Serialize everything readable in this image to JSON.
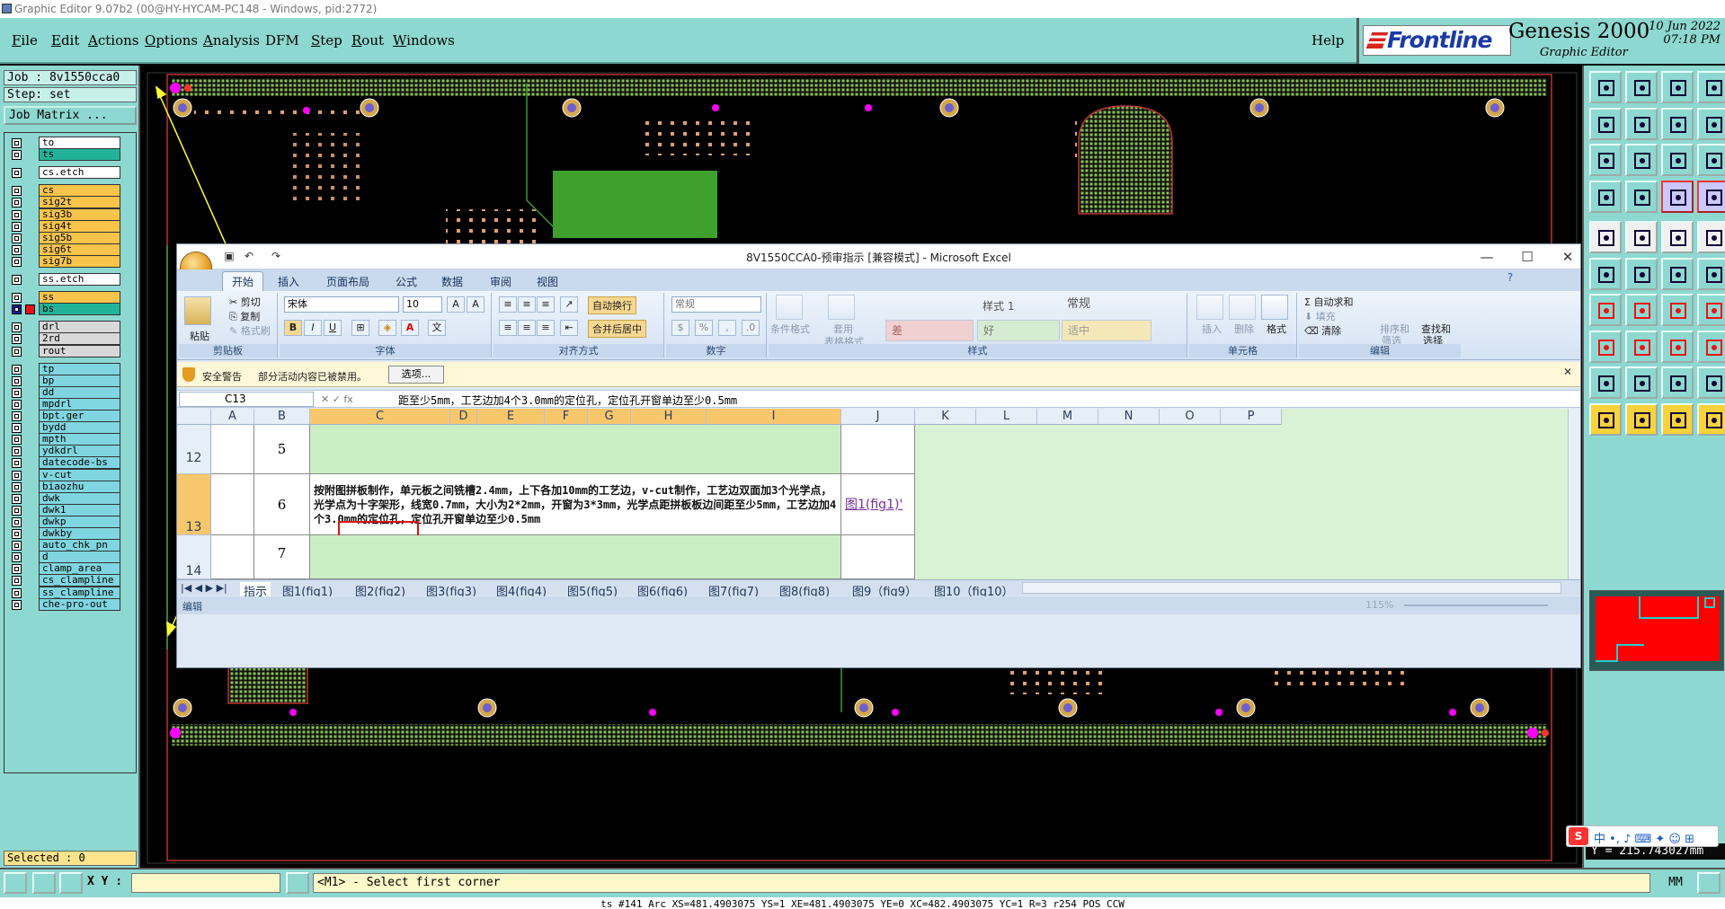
{
  "titlebar": {
    "text": "Graphic Editor 9.07b2 (00@HY-HYCAM-PC148 - Windows, pid:2772)"
  },
  "menu": {
    "items": [
      {
        "label": "File",
        "underline": "F",
        "rest": "ile"
      },
      {
        "label": "Edit",
        "underline": "E",
        "rest": "dit"
      },
      {
        "label": "Actions",
        "underline": "A",
        "rest": "ctions"
      },
      {
        "label": "Options",
        "underline": "O",
        "rest": "ptions"
      },
      {
        "label": "Analysis",
        "underline": "A",
        "rest": "nalysis"
      },
      {
        "label": "DFM",
        "underline": "",
        "rest": "DFM"
      },
      {
        "label": "Step",
        "underline": "S",
        "rest": "tep"
      },
      {
        "label": "Rout",
        "underline": "R",
        "rest": "out"
      },
      {
        "label": "Windows",
        "underline": "W",
        "rest": "indows"
      }
    ],
    "help": "Help"
  },
  "brand": {
    "logo": "Frontline",
    "product": "Genesis 2000",
    "subtitle": "Graphic Editor",
    "date": "10 Jun 2022",
    "time": "07:18 PM"
  },
  "left": {
    "job": "Job : 8v1550cca0",
    "step": "Step: set",
    "job_matrix": "Job Matrix ...",
    "selected": "Selected : 0",
    "layers": [
      {
        "name": "to",
        "color": "#ffffff",
        "gap": false
      },
      {
        "name": "ts",
        "color": "#22b39a",
        "gap": false
      },
      {
        "name": "cs.etch",
        "color": "#ffffff",
        "gap": true
      },
      {
        "name": "cs",
        "color": "#f8c44a",
        "gap": true
      },
      {
        "name": "sig2t",
        "color": "#f8c44a",
        "gap": false
      },
      {
        "name": "sig3b",
        "color": "#f8c44a",
        "gap": false
      },
      {
        "name": "sig4t",
        "color": "#f8c44a",
        "gap": false
      },
      {
        "name": "sig5b",
        "color": "#f8c44a",
        "gap": false
      },
      {
        "name": "sig6t",
        "color": "#f8c44a",
        "gap": false
      },
      {
        "name": "sig7b",
        "color": "#f8c44a",
        "gap": false
      },
      {
        "name": "ss.etch",
        "color": "#ffffff",
        "gap": true
      },
      {
        "name": "ss",
        "color": "#f8c44a",
        "gap": true
      },
      {
        "name": "bs",
        "color": "#22b39a",
        "gap": false,
        "active": true
      },
      {
        "name": "drl",
        "color": "#d8d8d8",
        "gap": true
      },
      {
        "name": "2rd",
        "color": "#d8d8d8",
        "gap": false
      },
      {
        "name": "rout",
        "color": "#d8d8d8",
        "gap": false
      },
      {
        "name": "tp",
        "color": "#7fd6e0",
        "gap": true
      },
      {
        "name": "bp",
        "color": "#7fd6e0",
        "gap": false
      },
      {
        "name": "dd",
        "color": "#7fd6e0",
        "gap": false
      },
      {
        "name": "mpdrl",
        "color": "#7fd6e0",
        "gap": false
      },
      {
        "name": "bpt.ger",
        "color": "#7fd6e0",
        "gap": false
      },
      {
        "name": "bydd",
        "color": "#7fd6e0",
        "gap": false
      },
      {
        "name": "mpth",
        "color": "#7fd6e0",
        "gap": false
      },
      {
        "name": "ydkdrl",
        "color": "#7fd6e0",
        "gap": false
      },
      {
        "name": "datecode-bs",
        "color": "#7fd6e0",
        "gap": false
      },
      {
        "name": "v-cut",
        "color": "#7fd6e0",
        "gap": false
      },
      {
        "name": "biaozhu",
        "color": "#7fd6e0",
        "gap": false
      },
      {
        "name": "dwk",
        "color": "#7fd6e0",
        "gap": false
      },
      {
        "name": "dwk1",
        "color": "#7fd6e0",
        "gap": false
      },
      {
        "name": "dwkp",
        "color": "#7fd6e0",
        "gap": false
      },
      {
        "name": "dwkby",
        "color": "#7fd6e0",
        "gap": false
      },
      {
        "name": "auto_chk_pn",
        "color": "#7fd6e0",
        "gap": false
      },
      {
        "name": "d",
        "color": "#7fd6e0",
        "gap": false
      },
      {
        "name": "clamp_area",
        "color": "#7fd6e0",
        "gap": false
      },
      {
        "name": "cs_clampline",
        "color": "#7fd6e0",
        "gap": false
      },
      {
        "name": "ss_clampline",
        "color": "#7fd6e0",
        "gap": false
      },
      {
        "name": "che-pro-out",
        "color": "#7fd6e0",
        "gap": false
      }
    ]
  },
  "excel": {
    "title": "8V1550CCA0-预审指示 [兼容模式] - Microsoft Excel",
    "tabs": [
      "开始",
      "插入",
      "页面布局",
      "公式",
      "数据",
      "审阅",
      "视图"
    ],
    "ribbon": {
      "clipboard": {
        "paste": "粘贴",
        "cut": "剪切",
        "copy": "复制",
        "format_painter": "格式刷",
        "label": "剪贴板"
      },
      "font": {
        "name": "宋体",
        "size": "10",
        "label": "字体"
      },
      "align": {
        "wrap": "自动换行",
        "merge": "合并后居中",
        "label": "对齐方式"
      },
      "number": {
        "format": "常规",
        "label": "数字"
      },
      "styles": {
        "cond": "条件格式",
        "table": "套用",
        "table2": "表格格式",
        "s1": "样式 1",
        "normal": "常规",
        "bad": "差",
        "good": "好",
        "neutral": "适中",
        "label": "样式"
      },
      "cells": {
        "insert": "插入",
        "delete": "删除",
        "format": "格式",
        "label": "单元格"
      },
      "edit": {
        "autosum": "自动求和",
        "fill": "填充",
        "clear": "清除",
        "sort": "排序和",
        "sort2": "筛选",
        "find": "查找和",
        "find2": "选择",
        "label": "编辑"
      }
    },
    "security": {
      "title": "安全警告",
      "message": "部分活动内容已被禁用。",
      "options": "选项..."
    },
    "namebox": "C13",
    "formula": "距至少5mm，工艺边加4个3.0mm的定位孔，定位孔开窗单边至少0.5mm",
    "columns": [
      "A",
      "B",
      "C",
      "D",
      "E",
      "F",
      "G",
      "H",
      "I",
      "J",
      "K",
      "L",
      "M",
      "N",
      "O",
      "P"
    ],
    "rows": [
      {
        "num": "12",
        "b": "5",
        "c": "",
        "j": ""
      },
      {
        "num": "13",
        "b": "6",
        "c": "按附图拼板制作，单元板之间铣槽2.4mm，上下各加10mm的工艺边，v-cut制作，工艺边双面加3个光学点，光学点为十字架形，线宽0.7mm，大小为2*2mm，开窗为3*3mm，光学点距拼板板边间距至少5mm，工艺边加4个3.0mm的定位孔，定位孔开窗单边至少0.5mm",
        "j": "图1(fig1)'"
      },
      {
        "num": "14",
        "b": "7",
        "c": "",
        "j": ""
      }
    ],
    "sheets": [
      "指示",
      "图1(fig1)",
      "图2(fig2)",
      "图3(fig3)",
      "图4(fig4)",
      "图5(fig5)",
      "图6(fig6)",
      "图7(fig7)",
      "图8(fig8)",
      "图9（fig9）",
      "图10（fig10）"
    ],
    "status": "编辑",
    "zoom": "115%"
  },
  "bottom": {
    "xy_label": "X Y :",
    "message": "<M1> - Select first corner",
    "units": "MM",
    "status_line": "ts #141 Arc XS=481.4903075 YS=1 XE=481.4903075 YE=0 XC=482.4903075 YC=1 R=3 r254 POS CCW",
    "coord_y": "Y = 215.743027mm"
  },
  "ime": {
    "text": "中 •, ♪ ⌨ ✦ ☺ ⊞"
  }
}
